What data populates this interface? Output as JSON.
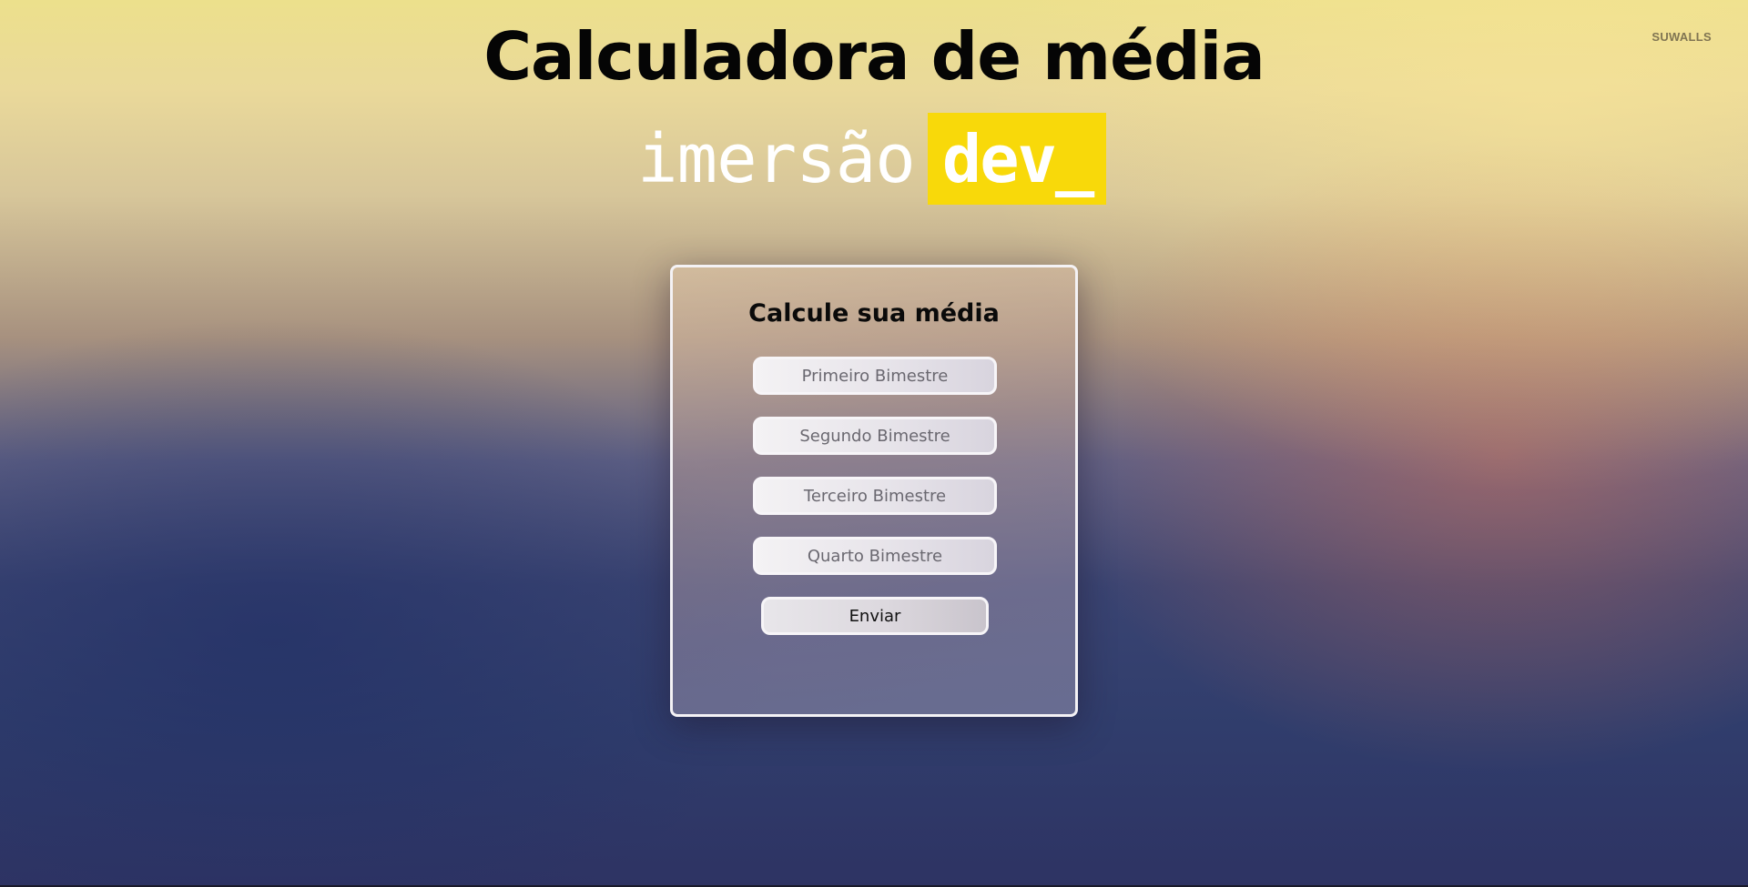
{
  "page": {
    "title": "Calculadora de média",
    "watermark": "SUWALLS"
  },
  "brand": {
    "left_text": "imersão",
    "right_text": "dev_",
    "accent_color": "#f8d90a"
  },
  "form": {
    "title": "Calcule sua média",
    "fields": [
      {
        "placeholder": "Primeiro Bimestre",
        "value": ""
      },
      {
        "placeholder": "Segundo Bimestre",
        "value": ""
      },
      {
        "placeholder": "Terceiro Bimestre",
        "value": ""
      },
      {
        "placeholder": "Quarto Bimestre",
        "value": ""
      }
    ],
    "submit_label": "Enviar"
  }
}
